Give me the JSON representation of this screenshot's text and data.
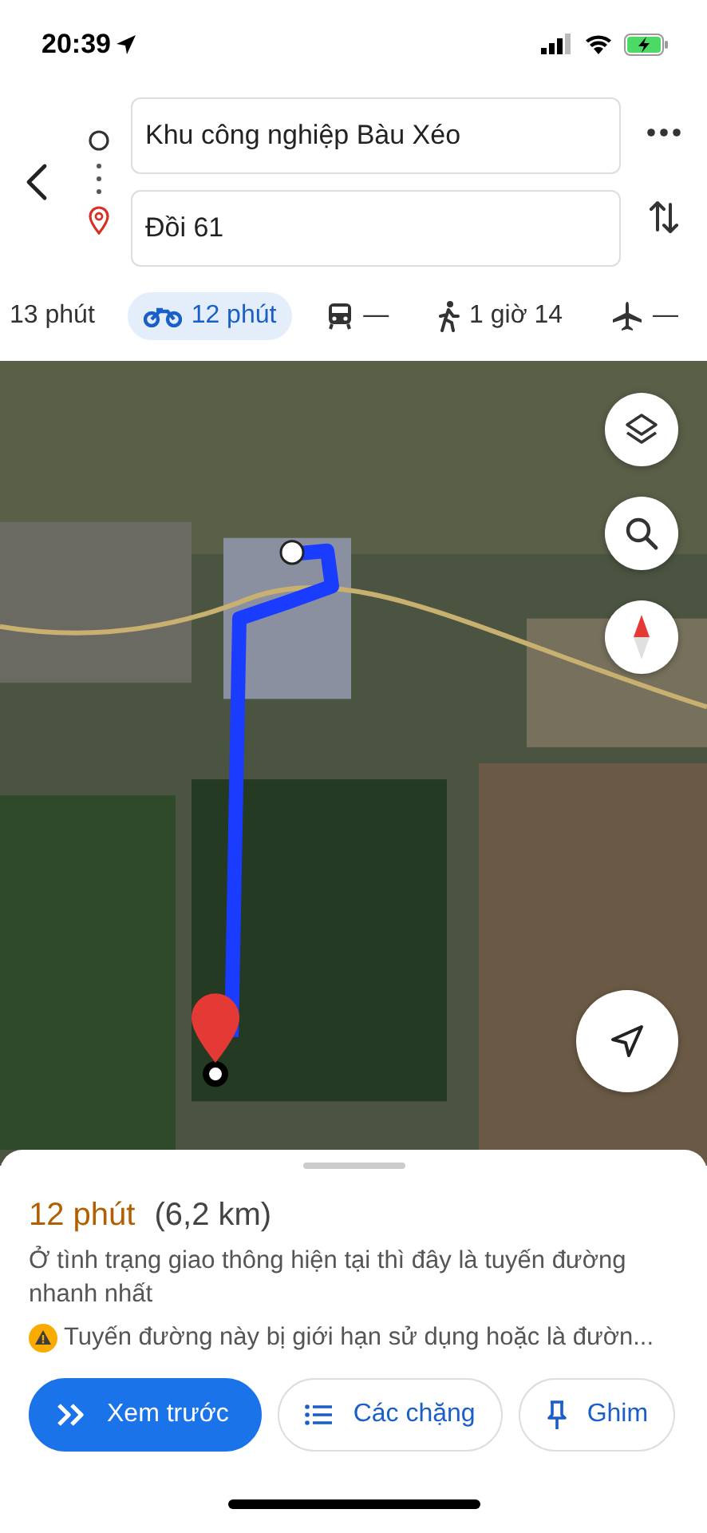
{
  "status_bar": {
    "time": "20:39"
  },
  "route": {
    "origin": {
      "value": "Khu công nghiệp Bàu Xéo"
    },
    "destination": {
      "value": "Đồi 61"
    }
  },
  "modes": [
    {
      "kind": "car",
      "label": "13 phút",
      "selected": false
    },
    {
      "kind": "motorbike",
      "label": "12 phút",
      "selected": true
    },
    {
      "kind": "transit",
      "label": "—",
      "selected": false
    },
    {
      "kind": "walk",
      "label": "1 giờ 14",
      "selected": false
    },
    {
      "kind": "flight",
      "label": "—",
      "selected": false
    }
  ],
  "summary": {
    "duration": "12 phút",
    "distance": "(6,2 km)",
    "description": "Ở tình trạng giao thông hiện tại thì đây là tuyến đường nhanh nhất",
    "warning": "Tuyến đường này bị giới hạn sử dụng hoặc là đườn..."
  },
  "actions": [
    {
      "kind": "preview",
      "label": "Xem trước"
    },
    {
      "kind": "steps",
      "label": "Các chặng"
    },
    {
      "kind": "pin",
      "label": "Ghim"
    }
  ]
}
